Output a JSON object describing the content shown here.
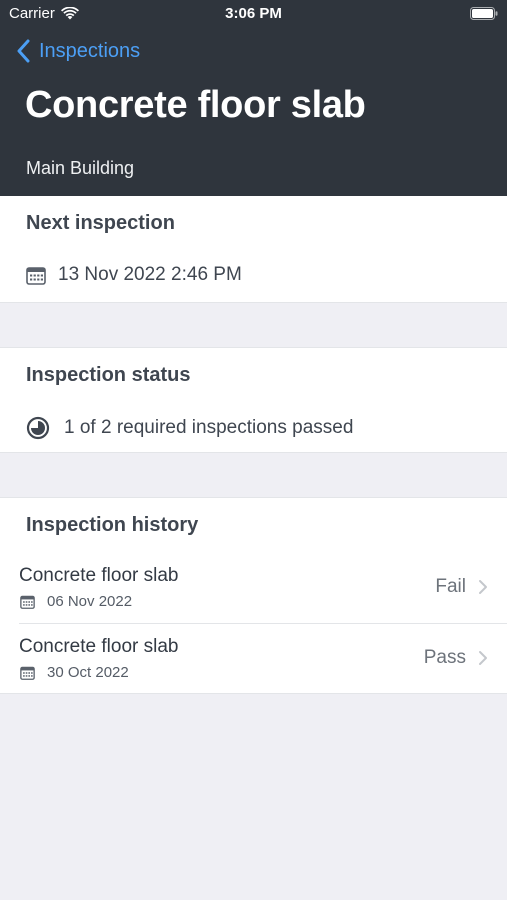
{
  "status_bar": {
    "carrier": "Carrier",
    "time": "3:06 PM",
    "icons": [
      "wifi-icon",
      "battery-icon"
    ]
  },
  "nav": {
    "back_label": "Inspections"
  },
  "header": {
    "title": "Concrete floor slab",
    "subtitle": "Main Building"
  },
  "next_inspection": {
    "title": "Next inspection",
    "date": "13 Nov 2022 2:46 PM",
    "icon": "calendar-icon"
  },
  "inspection_status": {
    "title": "Inspection status",
    "text": "1 of 2 required inspections passed",
    "icon": "progress-pie-icon"
  },
  "history": {
    "title": "Inspection history",
    "items": [
      {
        "name": "Concrete floor slab",
        "date": "06 Nov 2022",
        "result": "Fail"
      },
      {
        "name": "Concrete floor slab",
        "date": "30 Oct 2022",
        "result": "Pass"
      }
    ]
  },
  "colors": {
    "header_bg": "#2f353d",
    "accent": "#4c9ff5",
    "page_bg": "#efeff4"
  }
}
